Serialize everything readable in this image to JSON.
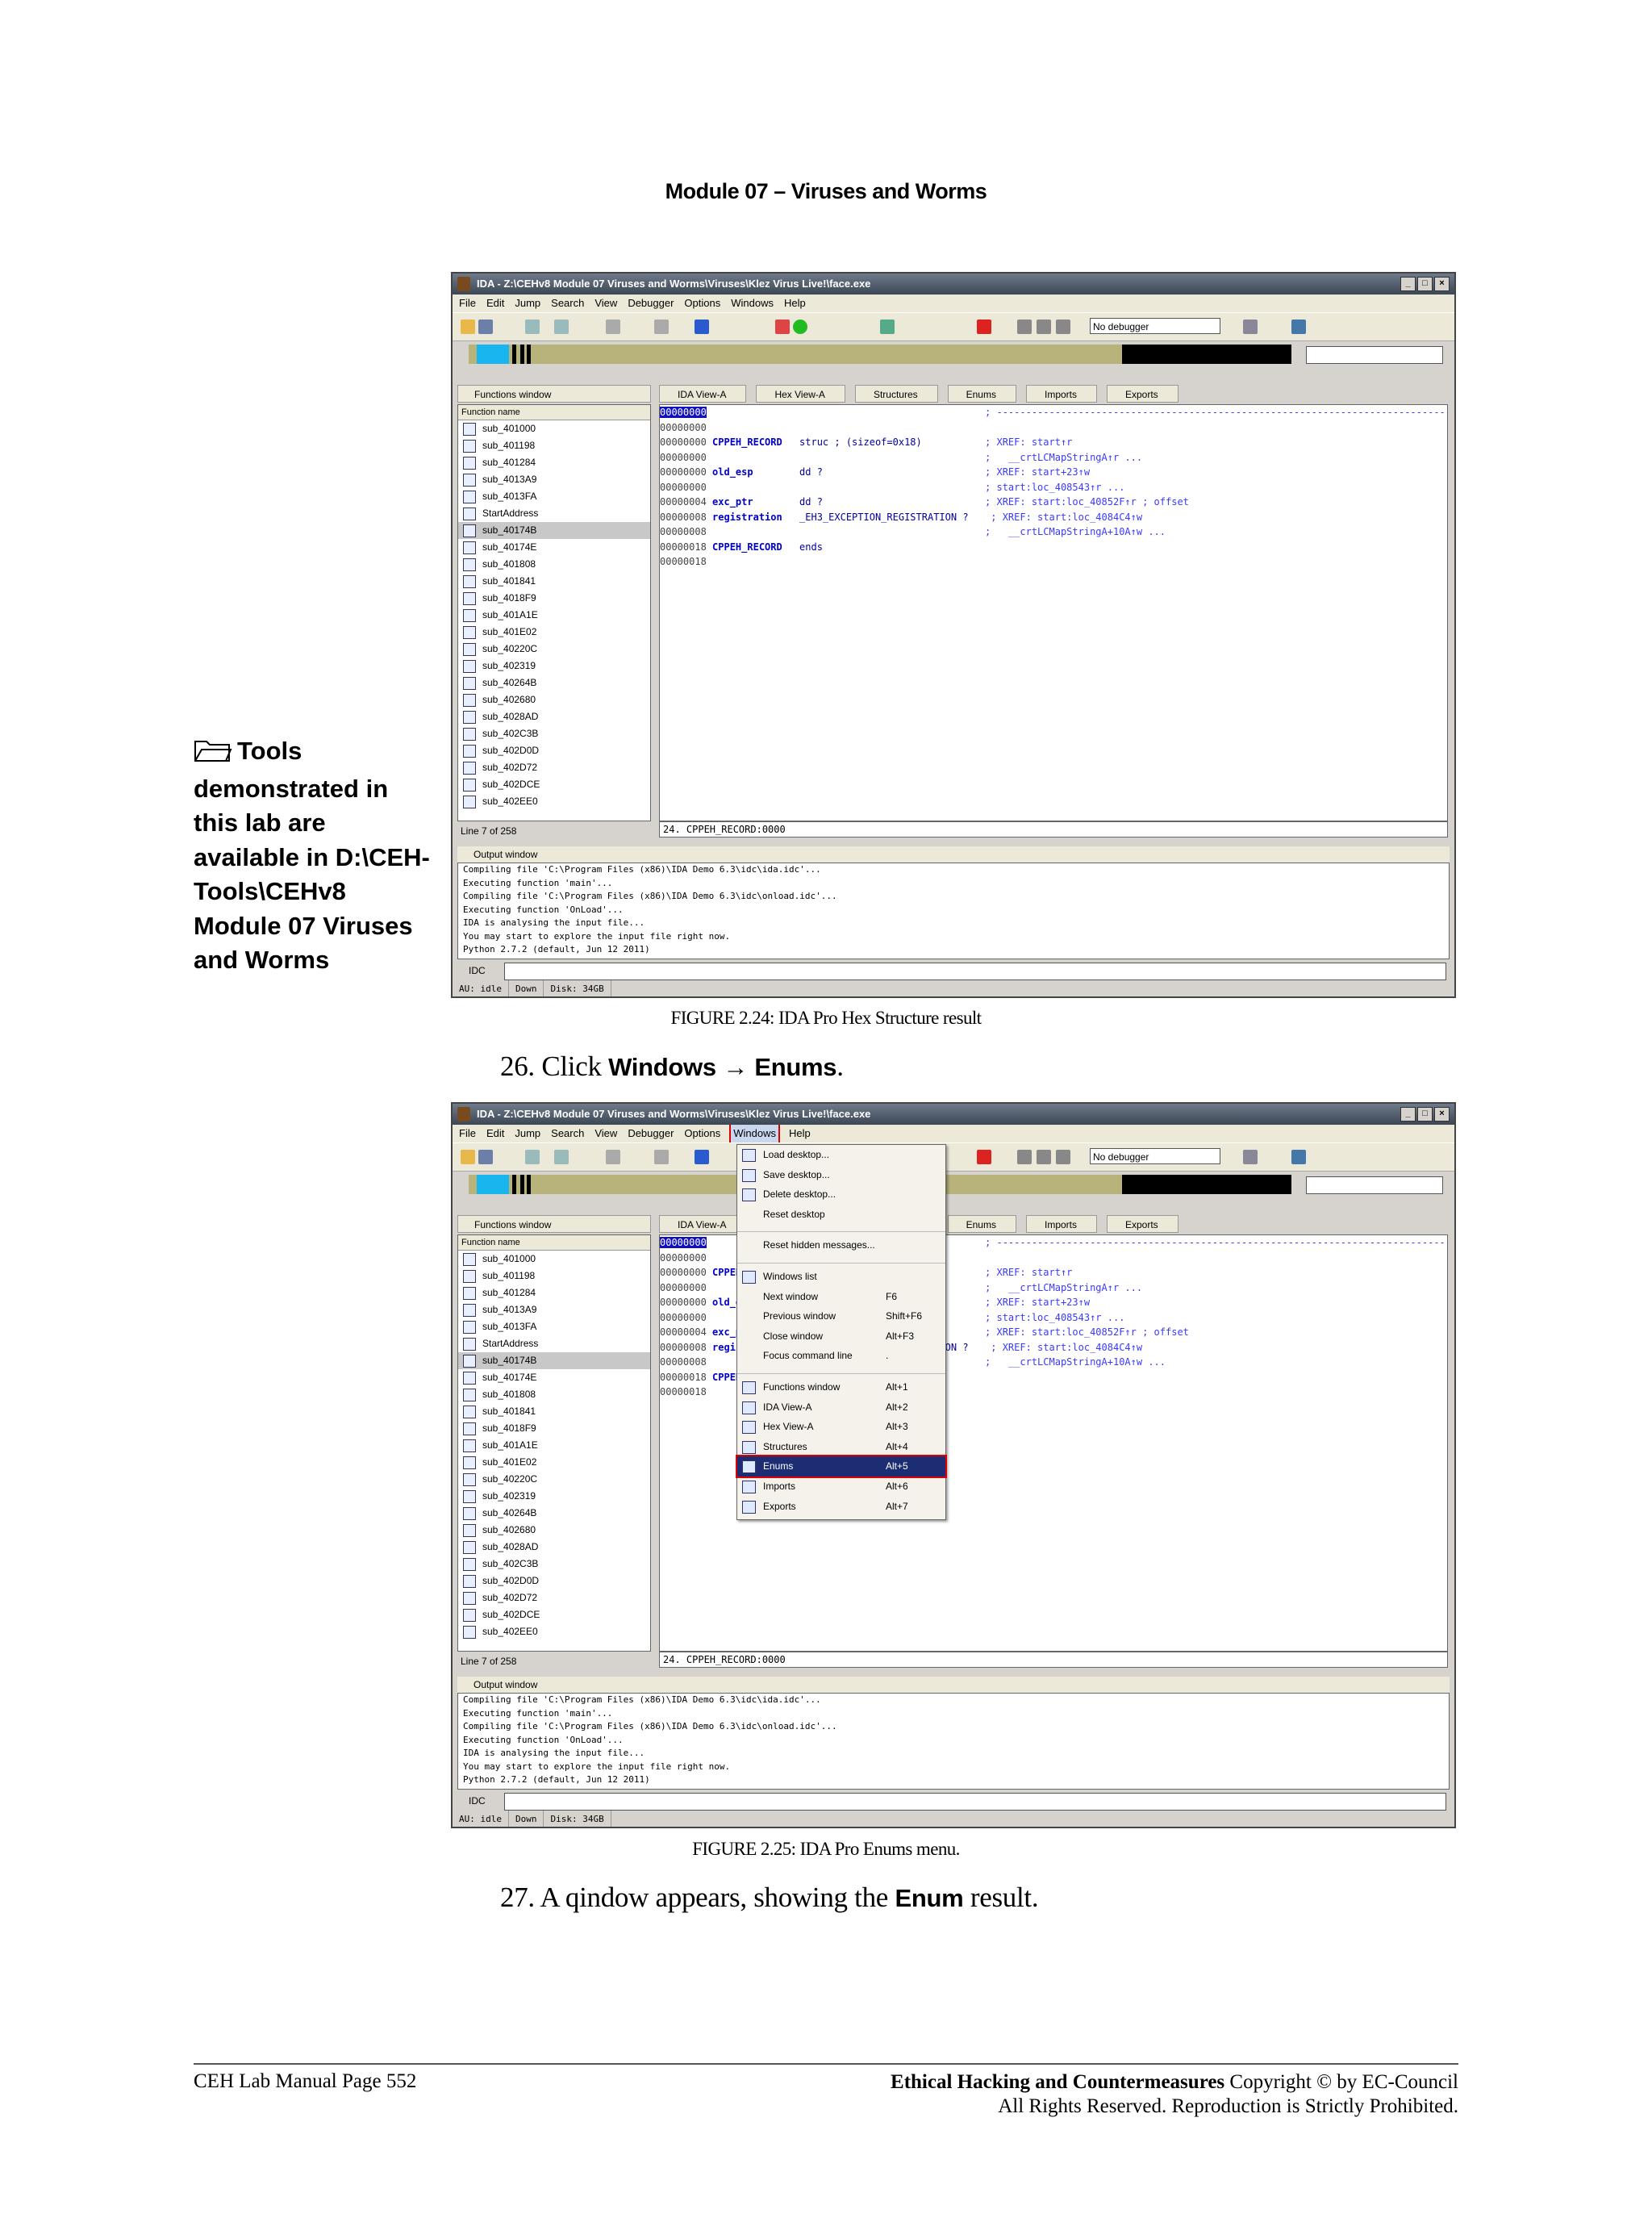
{
  "header": {
    "title": "Module 07 – Viruses and Worms"
  },
  "sidebar": {
    "note": "Tools demonstrated in this lab are available in D:\\CEH-Tools\\CEHv8 Module 07 Viruses and Worms"
  },
  "ida": {
    "title": "IDA - Z:\\CEHv8 Module 07 Viruses and Worms\\Viruses\\Klez Virus Live!\\face.exe",
    "menus": [
      "File",
      "Edit",
      "Jump",
      "Search",
      "View",
      "Debugger",
      "Options",
      "Windows",
      "Help"
    ],
    "debugger": "No debugger",
    "functions_window": "Functions window",
    "function_col": "Function name",
    "functions": [
      "sub_401000",
      "sub_401198",
      "sub_401284",
      "sub_4013A9",
      "sub_4013FA",
      "StartAddress",
      "sub_40174B",
      "sub_40174E",
      "sub_401808",
      "sub_401841",
      "sub_4018F9",
      "sub_401A1E",
      "sub_401E02",
      "sub_40220C",
      "sub_402319",
      "sub_40264B",
      "sub_402680",
      "sub_4028AD",
      "sub_402C3B",
      "sub_402D0D",
      "sub_402D72",
      "sub_402DCE",
      "sub_402EE0"
    ],
    "line_info": "Line 7 of 258",
    "tabs": [
      "IDA View-A",
      "Hex View-A",
      "Structures",
      "Enums",
      "Imports",
      "Exports"
    ],
    "code_lines": [
      {
        "addr": "00000000",
        "name": "",
        "op": "",
        "cm": "; -----------------------------------------------------------------------------------------------------------------"
      },
      {
        "addr": "00000000",
        "name": "",
        "op": "",
        "cm": ""
      },
      {
        "addr": "00000000",
        "name": "CPPEH_RECORD",
        "op": "struc ; (sizeof=0x18)",
        "cm": "; XREF: start↑r"
      },
      {
        "addr": "00000000",
        "name": "",
        "op": "",
        "cm": ";   __crtLCMapStringA↑r ..."
      },
      {
        "addr": "00000000",
        "name": "old_esp",
        "op": "dd ?",
        "cm": "; XREF: start+23↑w"
      },
      {
        "addr": "00000000",
        "name": "",
        "op": "",
        "cm": "; start:loc_408543↑r ..."
      },
      {
        "addr": "00000004",
        "name": "exc_ptr",
        "op": "dd ?",
        "cm": "; XREF: start:loc_40852F↑r ; offset"
      },
      {
        "addr": "00000008",
        "name": "registration",
        "op": "_EH3_EXCEPTION_REGISTRATION ?",
        "cm": " ; XREF: start:loc_4084C4↑w"
      },
      {
        "addr": "00000008",
        "name": "",
        "op": "",
        "cm": ";   __crtLCMapStringA+10A↑w ..."
      },
      {
        "addr": "00000018",
        "name": "CPPEH_RECORD",
        "op": "ends",
        "cm": ""
      },
      {
        "addr": "00000018",
        "name": "",
        "op": "",
        "cm": ""
      }
    ],
    "status_line": "24. CPPEH_RECORD:0000",
    "output_window": "Output window",
    "output_lines": [
      "Compiling file 'C:\\Program Files (x86)\\IDA Demo 6.3\\idc\\ida.idc'...",
      "Executing function 'main'...",
      "Compiling file 'C:\\Program Files (x86)\\IDA Demo 6.3\\idc\\onload.idc'...",
      "Executing function 'OnLoad'...",
      "IDA is analysing the input file...",
      "You may start to explore the input file right now.",
      "Python 2.7.2 (default, Jun 12 2011)"
    ],
    "idc_label": "IDC",
    "statusbar": [
      "AU:  idle",
      "Down",
      "Disk: 34GB"
    ]
  },
  "windows_menu": [
    {
      "label": "Load desktop...",
      "sc": ""
    },
    {
      "label": "Save desktop...",
      "sc": ""
    },
    {
      "label": "Delete desktop...",
      "sc": ""
    },
    {
      "label": "Reset desktop",
      "sc": ""
    },
    {
      "label": "Reset hidden messages...",
      "sc": ""
    },
    {
      "label": "Windows list",
      "sc": ""
    },
    {
      "label": "Next window",
      "sc": "F6"
    },
    {
      "label": "Previous window",
      "sc": "Shift+F6"
    },
    {
      "label": "Close window",
      "sc": "Alt+F3"
    },
    {
      "label": "Focus command line",
      "sc": "."
    },
    {
      "label": "Functions window",
      "sc": "Alt+1"
    },
    {
      "label": "IDA View-A",
      "sc": "Alt+2"
    },
    {
      "label": "Hex View-A",
      "sc": "Alt+3"
    },
    {
      "label": "Structures",
      "sc": "Alt+4"
    },
    {
      "label": "Enums",
      "sc": "Alt+5"
    },
    {
      "label": "Imports",
      "sc": "Alt+6"
    },
    {
      "label": "Exports",
      "sc": "Alt+7"
    }
  ],
  "captions": {
    "fig1": "FIGURE 2.24: IDA Pro Hex Structure result",
    "fig2": "FIGURE 2.25: IDA Pro Enums menu."
  },
  "steps": {
    "s26_num": "26.",
    "s26_pre": "Click",
    "s26_b1": "Windows",
    "s26_arrow": "→",
    "s26_b2": "Enums",
    "s26_end": ".",
    "s27_num": "27.",
    "s27_pre": "A qindow appears, showing the",
    "s27_b": "Enum",
    "s27_end": "result."
  },
  "footer": {
    "left": "CEH Lab Manual  Page 552",
    "right_b": "Ethical Hacking and Countermeasures",
    "right_1": "Copyright © by EC-Council",
    "right_2": "All Rights Reserved. Reproduction is Strictly Prohibited."
  }
}
